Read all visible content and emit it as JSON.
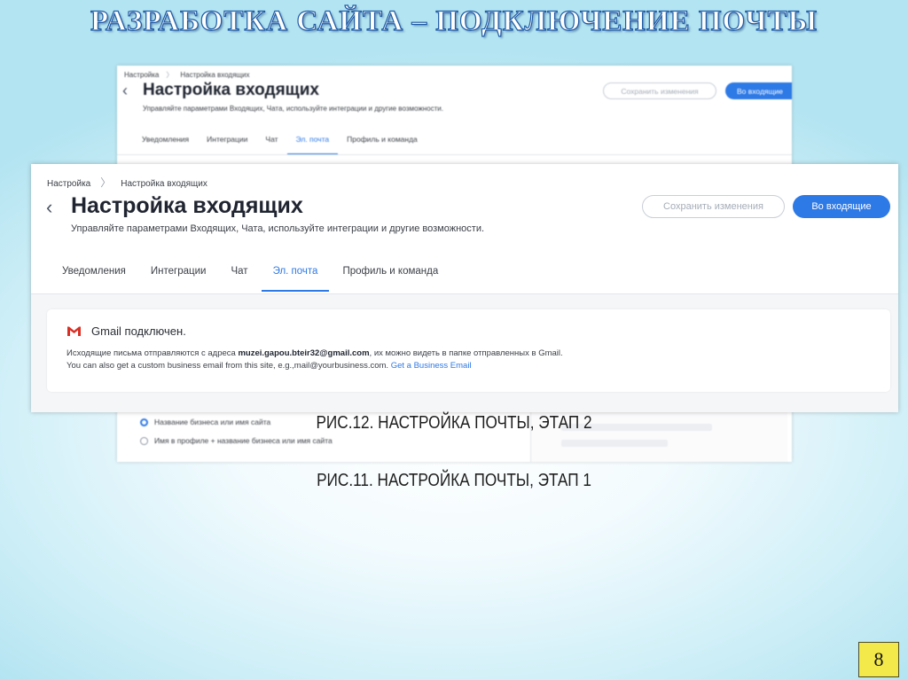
{
  "slide": {
    "title": "РАЗРАБОТКА САЙТА – ПОДКЛЮЧЕНИЕ ПОЧТЫ",
    "page_number": "8"
  },
  "screenshot_back": {
    "breadcrumb": [
      "Настройка",
      "Настройка входящих"
    ],
    "back_symbol": "‹",
    "header": "Настройка входящих",
    "subtitle": "Управляйте параметрами Входящих, Чата, используйте интеграции и другие возможности.",
    "save_button": "Сохранить изменения",
    "inbox_button": "Во входящие",
    "tabs": [
      "Уведомления",
      "Интеграции",
      "Чат",
      "Эл. почта",
      "Профиль и команда"
    ],
    "active_tab": 3,
    "radio_options": [
      {
        "label": "Название бизнеса или имя сайта",
        "selected": true
      },
      {
        "label": "Имя в профиле + название бизнеса или имя сайта",
        "selected": false
      }
    ]
  },
  "screenshot_front": {
    "breadcrumb": [
      "Настройка",
      "Настройка входящих"
    ],
    "back_symbol": "‹",
    "header": "Настройка входящих",
    "subtitle": "Управляйте параметрами Входящих, Чата, используйте интеграции и другие возможности.",
    "save_button": "Сохранить изменения",
    "inbox_button": "Во входящие",
    "tabs": [
      "Уведомления",
      "Интеграции",
      "Чат",
      "Эл. почта",
      "Профиль и команда"
    ],
    "active_tab": 3,
    "gmail_card": {
      "title": "Gmail подключен.",
      "line1_prefix": "Исходящие письма отправляются с адреса ",
      "email": "muzei.gapou.bteir32@gmail.com",
      "line1_suffix": ", их можно видеть в папке отправленных в Gmail.",
      "line2_text": "You can also get a custom business email from this site, e.g.,mail@yourbusiness.com. ",
      "line2_link": "Get a Business Email"
    }
  },
  "captions": {
    "fig12": "РИС.12. НАСТРОЙКА ПОЧТЫ, ЭТАП 2",
    "fig11": "РИС.11. НАСТРОЙКА ПОЧТЫ, ЭТАП 1"
  },
  "colors": {
    "accent": "#2d79e6",
    "title_outline": "#1f5aa6",
    "page_badge": "#f4e94a"
  }
}
